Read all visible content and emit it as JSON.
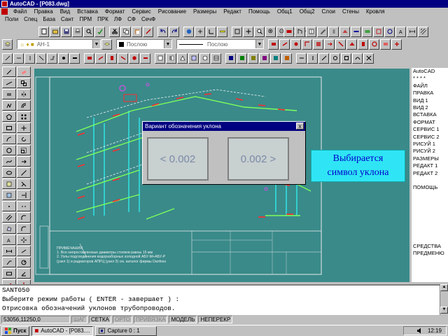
{
  "window": {
    "title": "AutoCAD - [P083.dwg]"
  },
  "menubar": {
    "items": [
      "Файл",
      "Правка",
      "Вид",
      "Вставка",
      "Формат",
      "Сервис",
      "Рисование",
      "Размеры",
      "Редакт",
      "Помощь",
      "Общ1",
      "Общ2",
      "Слои",
      "Стены",
      "Кровля"
    ]
  },
  "menubar2": {
    "items": [
      "Поли",
      "Спец",
      "База",
      "Сант",
      "ПРМ",
      "ПРК",
      "ЛФ",
      "СФ",
      "СечФ"
    ]
  },
  "properties": {
    "layer_value": "АН-1",
    "color_value": "Послою",
    "linetype_value": "Послою"
  },
  "side_menu": {
    "items": [
      "AutoCAD",
      "* * * *",
      "ФАЙЛ",
      "ПРАВКА",
      "ВИД 1",
      "ВИД 2",
      "ВСТАВКА",
      "ФОРМАТ",
      "СЕРВИС 1",
      "СЕРВИС 2",
      "РИСУЙ 1",
      "РИСУЙ 2",
      "РАЗМЕРЫ",
      "РЕДАКТ 1",
      "РЕДАКТ 2",
      "",
      "ПОМОЩЬ",
      "",
      "",
      "",
      "",
      "",
      "",
      "",
      "СРЕДСТВА",
      "ПРЕДМЕНЮ"
    ]
  },
  "dialog": {
    "title": "Вариант обозначения уклона",
    "option_left": "< 0.002",
    "option_right": "0.002 >",
    "close_label": "x"
  },
  "annotation": {
    "line1": "Выбирается",
    "line2": "символ уклона"
  },
  "command_line": {
    "lines": [
      "SANT050",
      "Выберите режим работы  ( ENTER - завершает ) :",
      "Отрисовка обозначений уклонов трубопроводов."
    ]
  },
  "statusbar": {
    "coords": "53056,11250,0",
    "toggles": [
      {
        "label": "ШАГ",
        "on": false
      },
      {
        "label": "СЕТКА",
        "on": true
      },
      {
        "label": "ОРТО",
        "on": false
      },
      {
        "label": "ПРИВЯЗКА",
        "on": false
      },
      {
        "label": "МОДЕЛЬ",
        "on": true
      },
      {
        "label": "НЕПЕРЕКР",
        "on": true
      }
    ]
  },
  "taskbar": {
    "start_label": "Пуск",
    "tasks": [
      "AutoCAD - [P083....",
      "Capture 0 : 1"
    ],
    "clock": "12:19"
  },
  "drawing": {
    "notes_title": "ПРИМЕЧАНИЯ",
    "note1": "1. Все непроставленные диаметры стояков равны 15 мм",
    "note2": "2. Узлы подсоединения водоразборных холодной АБУ-М+АБУ-Р",
    "note3": "(узел 1) и радиаторов АПРЦ (узел 3) см. каталог фирмы Danfoss"
  },
  "colors": {
    "canvas_bg": "#3a8a8a",
    "title_bar": "#000080",
    "annotation_bg": "#2fe5f5",
    "annotation_text": "#0000cc",
    "pipe_green": "#7cff5a",
    "pipe_red": "#ff2a2a",
    "pipe_cyan": "#30e0e0"
  }
}
